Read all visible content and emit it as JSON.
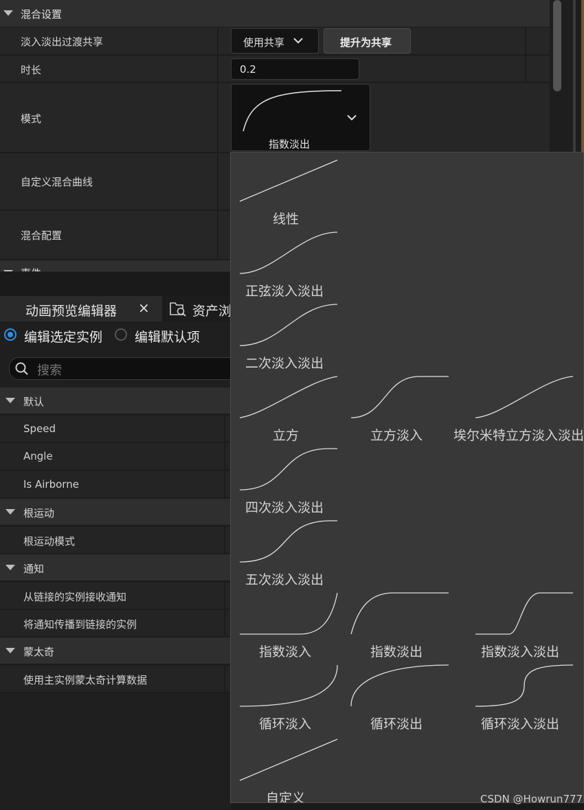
{
  "blend_settings": {
    "section_title": "混合设置",
    "rows": {
      "shared_label": "淡入淡出过渡共享",
      "duration_label": "时长",
      "mode_label": "模式",
      "custom_curve_label": "自定义混合曲线",
      "blend_profile_label": "混合配置"
    },
    "shared_dropdown": "使用共享",
    "promote_button": "提升为共享",
    "duration_value": "0.2",
    "mode_value": "指数淡出",
    "next_section_partial": "事件"
  },
  "bottom_panel": {
    "tab_title": "动画预览编辑器",
    "tab_close": "×",
    "tab2_title": "资产浏",
    "radio_edit_selected": "编辑选定实例",
    "radio_edit_defaults": "编辑默认项",
    "search_placeholder": "搜索",
    "categories": [
      {
        "label": "默认",
        "props": [
          "Speed",
          "Angle",
          "Is Airborne"
        ]
      },
      {
        "label": "根运动",
        "props": [
          "根运动模式"
        ]
      },
      {
        "label": "通知",
        "props": [
          "从链接的实例接收通知",
          "将通知传播到链接的实例"
        ]
      },
      {
        "label": "蒙太奇",
        "props": [
          "使用主实例蒙太奇计算数据"
        ]
      }
    ]
  },
  "blend_mode_menu": {
    "options": [
      {
        "label": "线性",
        "curve": "linear"
      },
      {
        "label": "正弦淡入淡出",
        "curve": "sine-in-out"
      },
      {
        "label": "二次淡入淡出",
        "curve": "quad-in-out"
      },
      {
        "label": "立方",
        "curve": "cubic"
      },
      {
        "label": "立方淡入",
        "curve": "cubic-in"
      },
      {
        "label": "埃尔米特立方淡入淡出",
        "curve": "hermite-cubic"
      },
      {
        "label": "四次淡入淡出",
        "curve": "quartic-in-out"
      },
      {
        "label": "五次淡入淡出",
        "curve": "quintic-in-out"
      },
      {
        "label": "指数淡入",
        "curve": "expo-in"
      },
      {
        "label": "指数淡出",
        "curve": "expo-out"
      },
      {
        "label": "指数淡入淡出",
        "curve": "expo-in-out"
      },
      {
        "label": "循环淡入",
        "curve": "circular-in"
      },
      {
        "label": "循环淡出",
        "curve": "circular-out"
      },
      {
        "label": "循环淡入淡出",
        "curve": "circular-in-out"
      },
      {
        "label": "自定义",
        "curve": "linear"
      }
    ]
  },
  "watermark": "CSDN @Howrun777",
  "colors": {
    "accent": "#2f8fe8",
    "panel": "#242424",
    "menu": "#383838"
  }
}
